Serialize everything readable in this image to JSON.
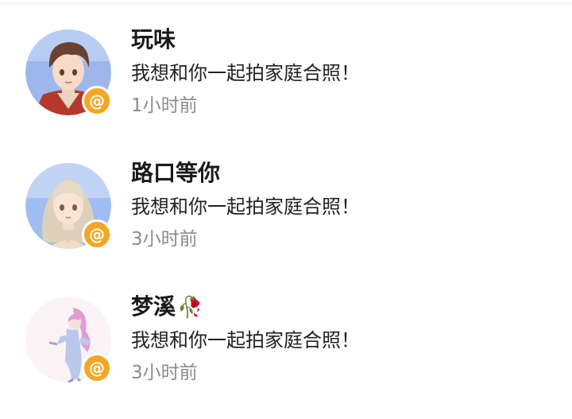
{
  "notifications": [
    {
      "name": "玩味",
      "message": "我想和你一起拍家庭合照！",
      "time": "1小时前",
      "badge": "@",
      "avatar": "avatar-boy-brown-hair"
    },
    {
      "name": "路口等你",
      "message": "我想和你一起拍家庭合照！",
      "time": "3小时前",
      "badge": "@",
      "avatar": "avatar-girl-blonde-hair"
    },
    {
      "name": "梦溪",
      "name_emoji": "🥀",
      "message": "我想和你一起拍家庭合照！",
      "time": "3小时前",
      "badge": "@",
      "avatar": "avatar-girl-pink-hair"
    }
  ],
  "colors": {
    "badge": "#f5a623",
    "name": "#1a1a1a",
    "message": "#222222",
    "time": "#8c8c8c"
  }
}
